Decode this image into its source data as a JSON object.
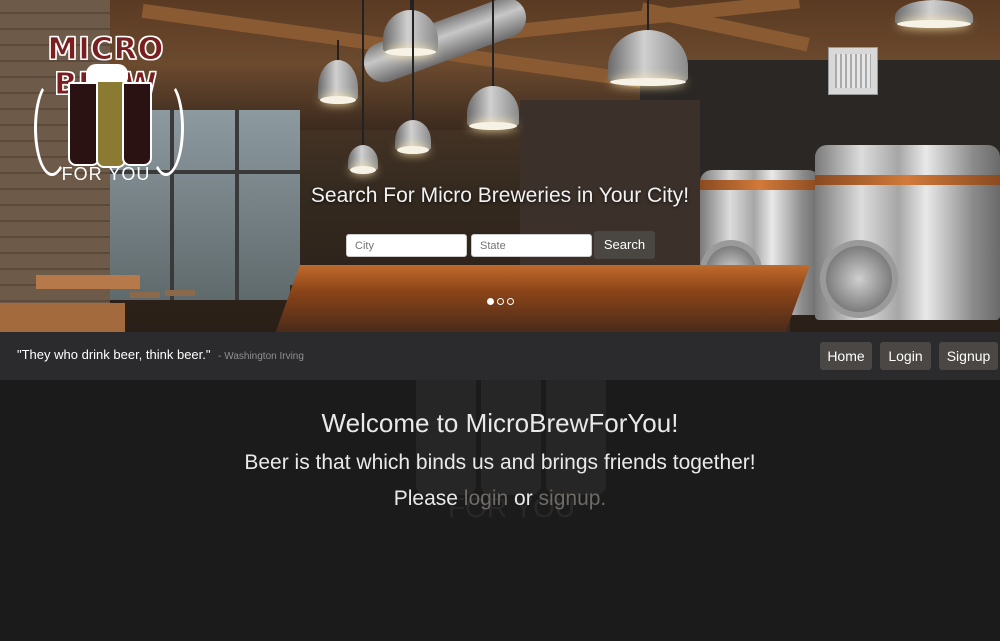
{
  "logo": {
    "top_text": "MICRO BREW",
    "bottom_text": "FOR YOU"
  },
  "hero": {
    "title": "Search For Micro Breweries in Your City!",
    "city_placeholder": "City",
    "state_placeholder": "State",
    "search_label": "Search",
    "carousel_active_index": 0,
    "carousel_count": 3
  },
  "quote_bar": {
    "quote": "\"They who drink beer, think beer.\"",
    "author": "- Washington Irving",
    "nav": [
      {
        "label": "Home"
      },
      {
        "label": "Login"
      },
      {
        "label": "Signup"
      }
    ]
  },
  "welcome": {
    "heading": "Welcome to MicroBrewForYou!",
    "subheading": "Beer is that which binds us and brings friends together!",
    "cta_prefix": "Please",
    "login_link": "login",
    "cta_middle": "or",
    "signup_link": "signup.",
    "watermark_text": "FOR YOU"
  },
  "colors": {
    "page_bg": "#1b1b1b",
    "quote_bar_bg": "#2b2b2d",
    "button_bg": "#4a4744",
    "link_color": "#6e6a66",
    "logo_red": "#7a1f1f"
  }
}
